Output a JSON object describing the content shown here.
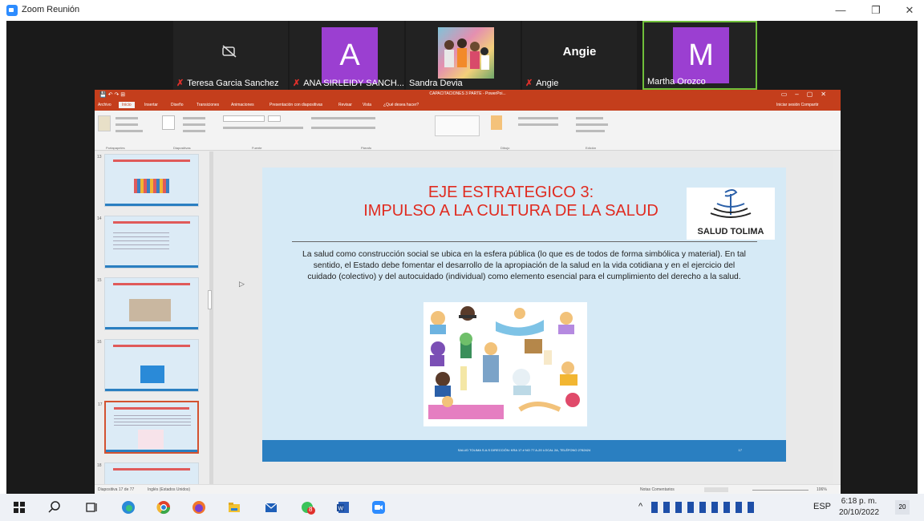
{
  "window": {
    "title": "Zoom Reunión",
    "minimize": "—",
    "maximize": "❐",
    "close": "✕"
  },
  "participants": [
    {
      "name": "Teresa Garcia Sanchez",
      "muted": true,
      "video": "camera-off"
    },
    {
      "name": "ANA SIRLEIDY SANCH...",
      "muted": true,
      "avatar_letter": "A",
      "avatar_color": "#9b3fd1"
    },
    {
      "name": "Sandra Devia",
      "muted": false,
      "video": "photo"
    },
    {
      "name": "Angie",
      "muted": true,
      "display_name": "Angie"
    },
    {
      "name": "Martha Orozco",
      "muted": false,
      "avatar_letter": "M",
      "avatar_color": "#9b3fd1",
      "active_speaker": true
    }
  ],
  "powerpoint": {
    "document_title": "CAPACITACIONES 3 PARTE - PowerPoi...",
    "tabs": [
      "Archivo",
      "Inicio",
      "Insertar",
      "Diseño",
      "Transiciones",
      "Animaciones",
      "Presentación con diapositivas",
      "Revisar",
      "Vista",
      "¿Qué desea hacer?"
    ],
    "active_tab": "Inicio",
    "right_tabs": "Iniciar sesión   Compartir",
    "ribbon_groups": [
      "Portapapeles",
      "Diapositivas",
      "Fuente",
      "Párrafo",
      "Dibujo",
      "Edición"
    ],
    "thumbnail_numbers": [
      "13",
      "14",
      "15",
      "16",
      "17",
      "18"
    ],
    "slide": {
      "title_line1": "EJE ESTRATEGICO 3:",
      "title_line2": "IMPULSO A LA CULTURA DE LA SALUD",
      "logo_text": "SALUD TOLIMA",
      "body": "La salud como construcción social se ubica en la esfera pública (lo que es de todos de forma simbólica y material). En tal sentido, el Estado debe fomentar el desarrollo de la apropiación de la salud en la vida cotidiana y en el ejercicio del cuidado (colectivo) y del autocuidado (individual) como elemento esencial para el cumplimiento del derecho a la salud.",
      "footer_text": "SALUD TOLIMA S.A.S DIRECCIÓN: KRA 17 # NO 77 A-20 LOCAL 2A, TELÉFONO 2782424",
      "page_number": "17"
    },
    "status_left": "Diapositiva 17 de 77",
    "status_lang": "Inglés (Estados Unidos)",
    "status_right": "Notas   Comentarios",
    "zoom": "106%"
  },
  "taskbar": {
    "language": "ESP",
    "time": "6:18 p. m.",
    "date": "20/10/2022",
    "notifications": "20",
    "badge": "8"
  }
}
